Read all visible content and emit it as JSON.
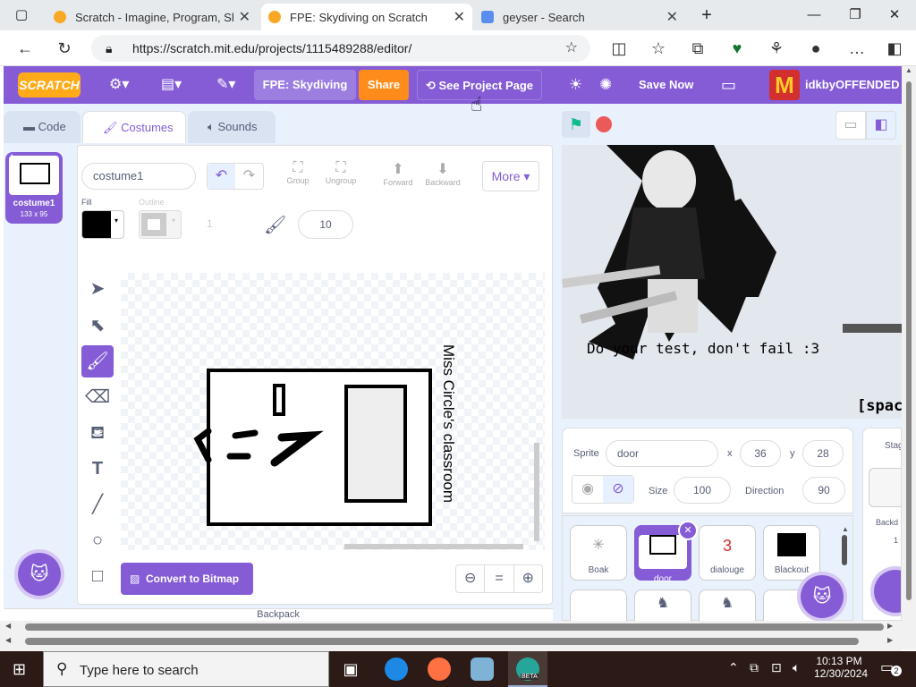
{
  "browser": {
    "tabs": [
      {
        "title": "Scratch - Imagine, Program, Share",
        "icon": "scratch-favicon-icon"
      },
      {
        "title": "FPE: Skydiving on Scratch",
        "icon": "scratch-favicon-icon"
      },
      {
        "title": "geyser - Search",
        "icon": "search-favicon-icon"
      }
    ],
    "url": "https://scratch.mit.edu/projects/1115489288/editor/"
  },
  "menubar": {
    "logo": "SCRATCH",
    "project_title": "FPE: Skydiving",
    "share_label": "Share",
    "see_project_label": "See Project Page",
    "save_label": "Save Now",
    "username": "idkbyOFFENDED"
  },
  "editor_tabs": {
    "code": "Code",
    "costumes": "Costumes",
    "sounds": "Sounds"
  },
  "costume_list": [
    {
      "index": "1",
      "name": "costume1",
      "size": "133 x 95"
    }
  ],
  "paint": {
    "costume_name": "costume1",
    "group_label": "Group",
    "ungroup_label": "Ungroup",
    "forward_label": "Forward",
    "backward_label": "Backward",
    "more_label": "More",
    "fill_label": "Fill",
    "outline_label": "Outline",
    "outline_width": "1",
    "brush_size": "10",
    "convert_label": "Convert to Bitmap",
    "canvas_text": "Miss Circle's classroom",
    "zoom_reset": "="
  },
  "stage": {
    "dialog_text": "Do your test, don't fail :3",
    "corner_text": "[space"
  },
  "sprite_info": {
    "sprite_label": "Sprite",
    "sprite_name": "door",
    "x_label": "x",
    "x_value": "36",
    "y_label": "y",
    "y_value": "28",
    "size_label": "Size",
    "size_value": "100",
    "direction_label": "Direction",
    "direction_value": "90"
  },
  "sprites": [
    {
      "name": "Boak"
    },
    {
      "name": "door"
    },
    {
      "name": "dialouge",
      "glyph": "3"
    },
    {
      "name": "Blackout"
    }
  ],
  "stage_panel": {
    "label": "Stag",
    "backdrops_label": "Backd",
    "backdrops_count": "1"
  },
  "bottom_partial": "Backpack",
  "taskbar": {
    "search_placeholder": "Type here to search",
    "time": "10:13 PM",
    "date": "12/30/2024",
    "notifications": "2",
    "beta_label": "BETA"
  }
}
